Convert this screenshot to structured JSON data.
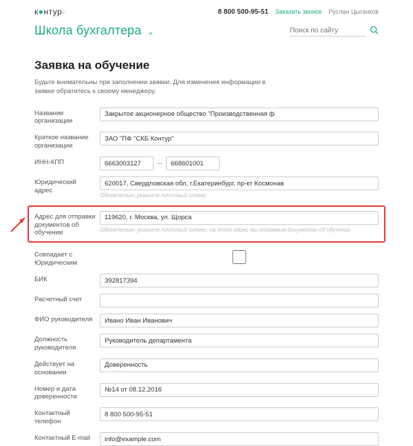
{
  "header": {
    "logo_text": "контур",
    "phone": "8 800 500-95-51",
    "call_link": "Заказать звонок",
    "user_name": "Руслан Цыганков",
    "school_title": "Школа бухгалтера",
    "search_placeholder": "Поиск по сайту"
  },
  "page": {
    "title": "Заявка на обучение",
    "intro": "Будьте внимательны при заполнении заявки. Для изменения информации в заявке обратитесь к своему менеджеру."
  },
  "form": {
    "org_name": {
      "label": "Название организации",
      "value": "Закрытое акционерное общество \"Производственная ф"
    },
    "short_name": {
      "label": "Краткое название организации",
      "value": "ЗАО \"ПФ \"СКБ Контур\""
    },
    "inn": {
      "label": "ИНН-КПП",
      "value1": "6663003127",
      "value2": "668601001"
    },
    "legal_addr": {
      "label": "Юридический адрес",
      "value": "620017, Свердловская обл, г.Екатеринбург, пр-кт Космонав",
      "hint": "Обязательно укажите почтовый индекс"
    },
    "doc_addr": {
      "label": "Адрес для отправки документов об обучении",
      "value": "119620, г. Москва, ул. Щорса",
      "hint": "Обязательно укажите почтовый индекс, на этот адрес мы отправим документы об обучении"
    },
    "same_as": {
      "label": "Совпадает с Юридическим"
    },
    "bik": {
      "label": "БИК",
      "value": "392817394"
    },
    "account": {
      "label": "Расчетный счет",
      "value": ""
    },
    "director": {
      "label": "ФИО руководителя",
      "value": "Ивано Иван Иванович"
    },
    "position": {
      "label": "Должность руководителя",
      "value": "Руководитель департамента"
    },
    "basis": {
      "label": "Действует на основании",
      "value": "Доверенность"
    },
    "doc_num": {
      "label": "Номер и дата доверенности",
      "value": "№14 от 08.12.2016"
    },
    "phone": {
      "label": "Контактный телефон",
      "value": "8 800 500-95-51"
    },
    "email": {
      "label": "Контактный E-mail",
      "value": "info@example.com"
    }
  }
}
